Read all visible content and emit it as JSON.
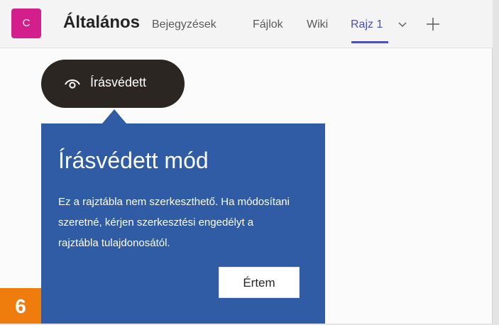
{
  "header": {
    "avatar_initial": "C",
    "avatar_color": "#d41e8b",
    "channel_title": "Általános",
    "tabs": [
      {
        "label": "Bejegyzések"
      },
      {
        "label": "Fájlok"
      },
      {
        "label": "Wiki"
      },
      {
        "label": "Rajz 1",
        "active": true,
        "icon": "chevron-down-icon"
      }
    ],
    "add_tab_icon": "plus-icon",
    "accent_color": "#4b4fb8"
  },
  "readonly_pill": {
    "icon": "eye-icon",
    "label": "Írásvédett"
  },
  "popup": {
    "title": "Írásvédett mód",
    "body": "Ez a rajztábla nem szerkeszthető. Ha módosítani szeretné, kérjen szerkesztési engedélyt a rajztábla tulajdonosától.",
    "button_label": "Értem",
    "background_color": "#2f5ca4"
  },
  "step_badge": {
    "label": "6",
    "color": "#ee7d0e"
  }
}
